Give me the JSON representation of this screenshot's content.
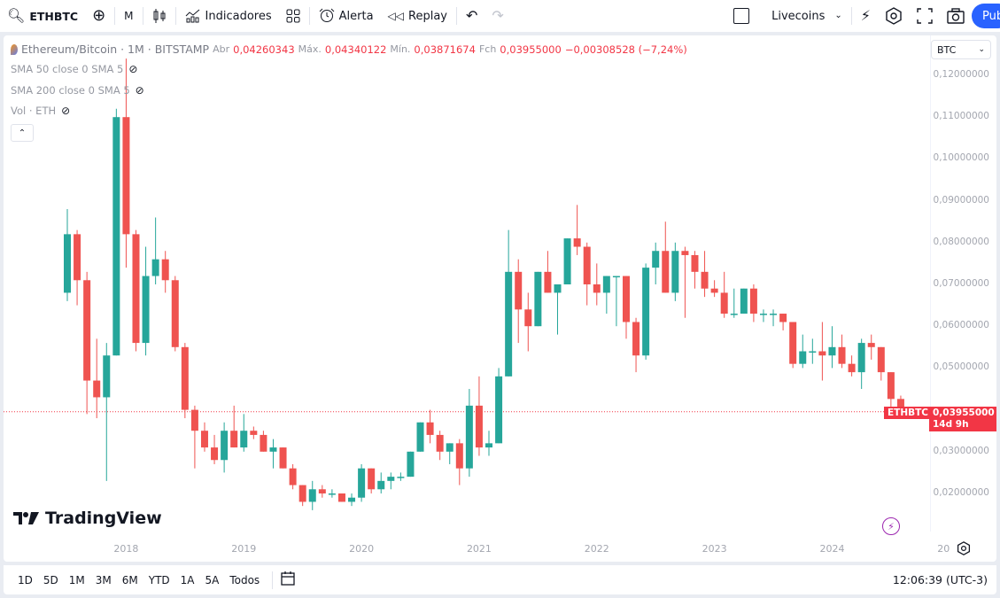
{
  "toolbar": {
    "symbol": "ETHBTC",
    "interval": "M",
    "indicators_label": "Indicadores",
    "alert_label": "Alerta",
    "replay_label": "Replay",
    "layout_name": "Livecoins",
    "publish_label": "Pub"
  },
  "legend": {
    "title": "Ethereum/Bitcoin · 1M · BITSTAMP",
    "open_label": "Abr",
    "open": "0,04260343",
    "high_label": "Máx.",
    "high": "0,04340122",
    "low_label": "Mín.",
    "low": "0,03871674",
    "close_label": "Fch",
    "close": "0,03955000",
    "change": "−0,00308528 (−7,24%)",
    "indicators": [
      "SMA 50 close 0 SMA 5",
      "SMA 200 close 0 SMA 5",
      "Vol · ETH"
    ]
  },
  "currency_select": "BTC",
  "last_price_tag": {
    "symbol": "ETHBTC",
    "price": "0,03955000",
    "countdown": "14d 9h"
  },
  "watermark": "TradingView",
  "bottom": {
    "ranges": [
      "1D",
      "5D",
      "1M",
      "3M",
      "6M",
      "YTD",
      "1A",
      "5A",
      "Todos"
    ],
    "time": "12:06:39 (UTC-3)"
  },
  "colors": {
    "up": "#26a69a",
    "down": "#ef5350",
    "last": "#f23645",
    "accent": "#2962ff"
  },
  "chart_data": {
    "type": "candlestick",
    "title": "Ethereum/Bitcoin · 1M · BITSTAMP",
    "ylabel": "BTC",
    "ylim": [
      0.015,
      0.125
    ],
    "y_ticks": [
      "0,12000000",
      "0,11000000",
      "0,10000000",
      "0,09000000",
      "0,08000000",
      "0,07000000",
      "0,06000000",
      "0,05000000",
      "0,03000000",
      "0,02000000"
    ],
    "x_ticks": [
      "2018",
      "2019",
      "2020",
      "2021",
      "2022",
      "2023",
      "2024",
      "20"
    ],
    "last_price": 0.03955,
    "candles": [
      [
        0.068,
        0.088,
        0.066,
        0.082
      ],
      [
        0.082,
        0.083,
        0.065,
        0.071
      ],
      [
        0.071,
        0.073,
        0.039,
        0.047
      ],
      [
        0.047,
        0.057,
        0.038,
        0.043
      ],
      [
        0.043,
        0.056,
        0.023,
        0.053
      ],
      [
        0.053,
        0.112,
        0.053,
        0.11
      ],
      [
        0.11,
        0.124,
        0.074,
        0.082
      ],
      [
        0.082,
        0.083,
        0.054,
        0.056
      ],
      [
        0.056,
        0.079,
        0.053,
        0.072
      ],
      [
        0.072,
        0.086,
        0.07,
        0.076
      ],
      [
        0.076,
        0.078,
        0.068,
        0.071
      ],
      [
        0.071,
        0.072,
        0.054,
        0.055
      ],
      [
        0.055,
        0.056,
        0.038,
        0.04
      ],
      [
        0.04,
        0.041,
        0.026,
        0.035
      ],
      [
        0.035,
        0.037,
        0.03,
        0.031
      ],
      [
        0.031,
        0.034,
        0.027,
        0.028
      ],
      [
        0.028,
        0.037,
        0.025,
        0.035
      ],
      [
        0.035,
        0.041,
        0.031,
        0.031
      ],
      [
        0.031,
        0.039,
        0.03,
        0.035
      ],
      [
        0.035,
        0.036,
        0.033,
        0.034
      ],
      [
        0.034,
        0.035,
        0.03,
        0.03
      ],
      [
        0.03,
        0.033,
        0.026,
        0.031
      ],
      [
        0.031,
        0.031,
        0.027,
        0.026
      ],
      [
        0.026,
        0.027,
        0.021,
        0.022
      ],
      [
        0.022,
        0.022,
        0.017,
        0.018
      ],
      [
        0.018,
        0.023,
        0.016,
        0.021
      ],
      [
        0.021,
        0.022,
        0.019,
        0.02
      ],
      [
        0.02,
        0.021,
        0.019,
        0.02
      ],
      [
        0.02,
        0.019,
        0.018,
        0.018
      ],
      [
        0.018,
        0.02,
        0.017,
        0.019
      ],
      [
        0.019,
        0.027,
        0.018,
        0.026
      ],
      [
        0.026,
        0.025,
        0.02,
        0.021
      ],
      [
        0.021,
        0.025,
        0.02,
        0.023
      ],
      [
        0.023,
        0.025,
        0.021,
        0.024
      ],
      [
        0.024,
        0.025,
        0.023,
        0.024
      ],
      [
        0.024,
        0.03,
        0.024,
        0.03
      ],
      [
        0.03,
        0.034,
        0.03,
        0.037
      ],
      [
        0.037,
        0.04,
        0.032,
        0.034
      ],
      [
        0.034,
        0.035,
        0.028,
        0.03
      ],
      [
        0.03,
        0.032,
        0.027,
        0.032
      ],
      [
        0.032,
        0.033,
        0.022,
        0.026
      ],
      [
        0.026,
        0.045,
        0.024,
        0.041
      ],
      [
        0.041,
        0.048,
        0.029,
        0.031
      ],
      [
        0.031,
        0.035,
        0.029,
        0.032
      ],
      [
        0.032,
        0.05,
        0.032,
        0.048
      ],
      [
        0.048,
        0.083,
        0.048,
        0.073
      ],
      [
        0.073,
        0.076,
        0.056,
        0.064
      ],
      [
        0.064,
        0.068,
        0.054,
        0.06
      ],
      [
        0.06,
        0.073,
        0.06,
        0.073
      ],
      [
        0.073,
        0.078,
        0.07,
        0.068
      ],
      [
        0.068,
        0.069,
        0.058,
        0.07
      ],
      [
        0.07,
        0.081,
        0.07,
        0.081
      ],
      [
        0.081,
        0.089,
        0.077,
        0.079
      ],
      [
        0.079,
        0.08,
        0.065,
        0.07
      ],
      [
        0.07,
        0.075,
        0.065,
        0.068
      ],
      [
        0.068,
        0.071,
        0.063,
        0.072
      ],
      [
        0.072,
        0.072,
        0.06,
        0.072
      ],
      [
        0.072,
        0.072,
        0.057,
        0.061
      ],
      [
        0.061,
        0.062,
        0.049,
        0.053
      ],
      [
        0.053,
        0.075,
        0.052,
        0.074
      ],
      [
        0.074,
        0.08,
        0.07,
        0.078
      ],
      [
        0.078,
        0.085,
        0.068,
        0.068
      ],
      [
        0.068,
        0.08,
        0.066,
        0.078
      ],
      [
        0.078,
        0.079,
        0.062,
        0.077
      ],
      [
        0.077,
        0.078,
        0.069,
        0.073
      ],
      [
        0.073,
        0.078,
        0.067,
        0.069
      ],
      [
        0.069,
        0.071,
        0.067,
        0.068
      ],
      [
        0.068,
        0.073,
        0.062,
        0.063
      ],
      [
        0.063,
        0.069,
        0.062,
        0.063
      ],
      [
        0.063,
        0.069,
        0.063,
        0.069
      ],
      [
        0.069,
        0.07,
        0.061,
        0.063
      ],
      [
        0.063,
        0.064,
        0.061,
        0.063
      ],
      [
        0.063,
        0.064,
        0.06,
        0.063
      ],
      [
        0.063,
        0.063,
        0.059,
        0.061
      ],
      [
        0.061,
        0.061,
        0.05,
        0.051
      ],
      [
        0.051,
        0.058,
        0.05,
        0.054
      ],
      [
        0.054,
        0.057,
        0.051,
        0.054
      ],
      [
        0.054,
        0.061,
        0.047,
        0.053
      ],
      [
        0.053,
        0.06,
        0.05,
        0.055
      ],
      [
        0.055,
        0.058,
        0.05,
        0.051
      ],
      [
        0.051,
        0.053,
        0.048,
        0.049
      ],
      [
        0.049,
        0.057,
        0.045,
        0.056
      ],
      [
        0.056,
        0.058,
        0.052,
        0.055
      ],
      [
        0.055,
        0.055,
        0.047,
        0.049
      ],
      [
        0.049,
        0.049,
        0.04,
        0.0426
      ],
      [
        0.04260343,
        0.04340122,
        0.03871674,
        0.03955
      ]
    ]
  }
}
